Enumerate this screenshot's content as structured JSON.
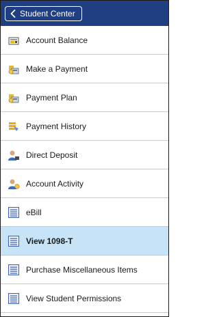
{
  "header": {
    "back_label": "Student Center",
    "color": "#1f3f82"
  },
  "menu": {
    "items": [
      {
        "label": "Account Balance",
        "icon": "account-balance-icon"
      },
      {
        "label": "Make a Payment",
        "icon": "make-payment-icon"
      },
      {
        "label": "Payment Plan",
        "icon": "payment-plan-icon"
      },
      {
        "label": "Payment History",
        "icon": "payment-history-icon"
      },
      {
        "label": "Direct Deposit",
        "icon": "direct-deposit-icon"
      },
      {
        "label": "Account Activity",
        "icon": "account-activity-icon"
      },
      {
        "label": "eBill",
        "icon": "document-icon"
      },
      {
        "label": "View 1098-T",
        "icon": "document-icon",
        "selected": true
      },
      {
        "label": "Purchase Miscellaneous Items",
        "icon": "document-icon"
      },
      {
        "label": "View Student Permissions",
        "icon": "document-icon"
      }
    ],
    "selected_color": "#c6e3f7"
  }
}
